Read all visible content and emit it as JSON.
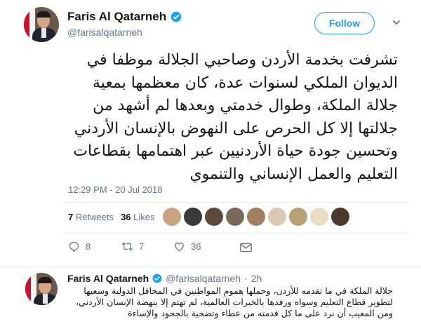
{
  "tweet": {
    "author_name": "Faris Al Qatarneh",
    "author_handle": "@farisalqatarneh",
    "follow_label": "Follow",
    "text": "تشرفت بخدمة الأردن وصاحبي الجلالة موظفا في الديوان الملكي لسنوات عدة، كان معظمها بمعية جلالة الملكة، وطوال خدمتي وبعدها لم أشهد من جلالتها إلا كل الحرص على النهوض بالإنسان الأردني وتحسين جودة حياة الأردنيين عبر اهتمامها بقطاعات التعليم والعمل الإنساني والتنموي",
    "timestamp": "12:29 PM - 20 Jul 2018",
    "retweets_count": "7",
    "retweets_label": "Retweets",
    "likes_count": "36",
    "likes_label": "Likes",
    "actions": {
      "reply_count": "8",
      "retweet_count": "7",
      "like_count": "36"
    },
    "icons": [
      "verified-badge-icon",
      "chevron-down-icon",
      "reply-icon",
      "retweet-icon",
      "heart-icon",
      "mail-icon"
    ],
    "liker_avatar_colors": [
      "#c9a27e",
      "#3a3a3a",
      "#5b4a3e",
      "#7a6a5c",
      "#a08060",
      "#d9c9b5",
      "#b8a078",
      "#e8dcc5",
      "#4a3a2e"
    ],
    "colors": {
      "accent": "#1da1f2",
      "muted": "#657786",
      "text": "#14171a",
      "border": "#e6ecf0"
    }
  },
  "reply": {
    "author_name": "Faris Al Qatarneh",
    "author_handle": "@farisalqatarneh",
    "time": "2h",
    "text": "جلالة الملكة في ما تقدمه للأردن، وحملها همومِ المواطنين في المحافل الدولية وسعيها لتطوير قطاع التعليم وسواه ورفدها بالخبرات العالمية، لم تهتم إلا بنهضة الإنسان الأردني، ومن المعيب أن نرد على ما كل قدمته من عطاء وتضحية بالجحود والإساءة"
  }
}
